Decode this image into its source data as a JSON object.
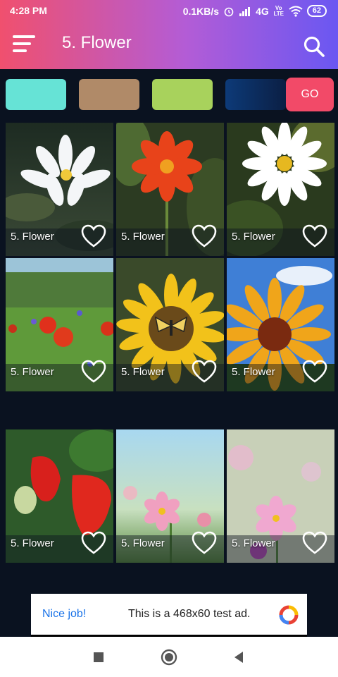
{
  "status": {
    "time": "4:28 PM",
    "net_speed": "0.1KB/s",
    "network": "4G",
    "volte": "Vo LTE",
    "battery": "62"
  },
  "appbar": {
    "title": "5. Flower",
    "menu_icon": "hamburger-menu-icon",
    "search_icon": "search-icon"
  },
  "swatches": {
    "colors": [
      "#66e3d6",
      "#b08a68",
      "#a8d25c",
      "#0d3a78"
    ],
    "go_label": "GO",
    "go_color": "#f24a68"
  },
  "tiles": [
    {
      "label": "5. Flower",
      "subject": "white water lily"
    },
    {
      "label": "5. Flower",
      "subject": "orange zinnia"
    },
    {
      "label": "5. Flower",
      "subject": "white daisy"
    },
    {
      "label": "5. Flower",
      "subject": "poppy meadow"
    },
    {
      "label": "5. Flower",
      "subject": "sunflower with butterfly"
    },
    {
      "label": "5. Flower",
      "subject": "sunflower sky"
    },
    {
      "label": "5. Flower",
      "subject": "strawberries"
    },
    {
      "label": "5. Flower",
      "subject": "pink cosmos"
    },
    {
      "label": "5. Flower",
      "subject": "pink cosmos field"
    }
  ],
  "ad": {
    "left_text": "Nice job!",
    "right_text": "This is a 468x60 test ad."
  },
  "navbar": {
    "recent_icon": "square-recents-icon",
    "home_icon": "circle-home-icon",
    "back_icon": "triangle-back-icon"
  }
}
